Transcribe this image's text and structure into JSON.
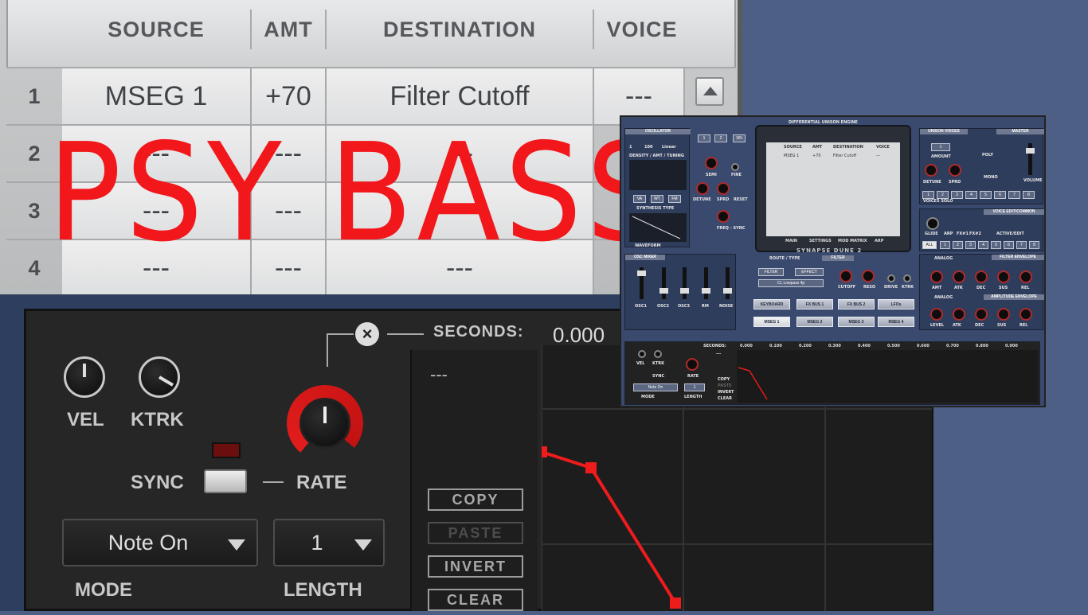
{
  "overlay_title": "PSY BASS",
  "matrix": {
    "headers": [
      "SOURCE",
      "AMT",
      "DESTINATION",
      "VOICE"
    ],
    "rows": [
      {
        "num": "1",
        "source": "MSEG 1",
        "amt": "+70",
        "destination": "Filter Cutoff",
        "voice": "---"
      },
      {
        "num": "2",
        "source": "---",
        "amt": "---",
        "destination": "---",
        "voice": ""
      },
      {
        "num": "3",
        "source": "---",
        "amt": "---",
        "destination": "---",
        "voice": ""
      },
      {
        "num": "4",
        "source": "---",
        "amt": "---",
        "destination": "---",
        "voice": ""
      }
    ]
  },
  "mseg": {
    "vel_label": "VEL",
    "ktrk_label": "KTRK",
    "sync_label": "SYNC",
    "rate_label": "RATE",
    "seconds_label": "SECONDS:",
    "seconds_value": "0.000",
    "placeholder": "---",
    "mode_value": "Note On",
    "mode_label": "MODE",
    "length_value": "1",
    "length_label": "LENGTH",
    "copy": "COPY",
    "paste": "PASTE",
    "invert": "INVERT",
    "clear": "CLEAR",
    "accent": "#ee1c1c"
  },
  "synth": {
    "osc_header": "OSCILLATOR",
    "osc_vals": [
      "1",
      "100",
      "Linear"
    ],
    "density_label": "DENSITY / AMT / TUNING",
    "synthesis_btns": [
      "VA",
      "WT",
      "FM"
    ],
    "synthesis_label": "SYNTHESIS TYPE",
    "waveform_label": "WAVEFORM",
    "osc_tabs": [
      "1",
      "2",
      "3/N"
    ],
    "semi": "SEMI",
    "fine": "FINE",
    "detune": "DETUNE",
    "sprd": "SPRD",
    "reset": "RESET",
    "freq_sync": "FREQ - SYNC",
    "engine_title": "DIFFERENTIAL UNISON ENGINE",
    "screen_headers": [
      "SOURCE",
      "AMT",
      "DESTINATION",
      "VOICE"
    ],
    "screen_row1": [
      "MSEG 1",
      "+70",
      "Filter Cutoff",
      "---"
    ],
    "screen_tabs": [
      "MAIN",
      "SETTINGS",
      "MOD MATRIX",
      "ARP"
    ],
    "brand": "SYNAPSE DUNE 2",
    "unison_header": "UNISON VOICES",
    "unison_val": "1",
    "amount": "AMOUNT",
    "u_detune": "DETUNE",
    "u_sprd": "SPRD",
    "voices_solo": "VOICES SOLO",
    "master_header": "MASTER",
    "poly": "POLY",
    "mono": "MONO",
    "volume": "VOLUME",
    "voice_edit_header": "VOICE EDIT/COMMON",
    "glide": "GLIDE",
    "arp": "ARP",
    "fx1": "FX#1",
    "fx2": "FX#2",
    "active_edit": "ACTIVE/EDIT",
    "all": "ALL",
    "voice_nums": [
      "1",
      "2",
      "3",
      "4",
      "5",
      "6",
      "7",
      "8"
    ],
    "mixer_header": "OSC MIXER",
    "mixer_ch": [
      "OSC1",
      "OSC2",
      "OSC3",
      "RM",
      "NOISE"
    ],
    "route_type": "ROUTE / TYPE",
    "filter_header": "FILTER",
    "filter_dd": "FILTER",
    "effect_dd": "EFFECT",
    "filter_type": "CL Lowpass 4p",
    "cutoff": "CUTOFF",
    "reso": "RESO",
    "drive": "DRIVE",
    "ktrk": "KTRK",
    "mod_btns_row1": [
      "KEYBOARD",
      "FX BUS 1",
      "FX BUS 2",
      "LFOs"
    ],
    "mod_btns_row2": [
      "MSEG 1",
      "MSEG 2",
      "MSEG 3",
      "MSEG 4"
    ],
    "filter_env_header": "FILTER ENVELOPE",
    "analog": "ANALOG",
    "fenv": [
      "AMT",
      "ATK",
      "DEC",
      "SUS",
      "REL"
    ],
    "amp_env_header": "AMPLITUDE ENVELOPE",
    "aenv": [
      "LEVEL",
      "ATK",
      "DEC",
      "SUS",
      "REL"
    ],
    "mini_seconds": "SECONDS:",
    "ruler": [
      "0.000",
      "0.100",
      "0.200",
      "0.300",
      "0.400",
      "0.500",
      "0.600",
      "0.700",
      "0.800",
      "0.900"
    ],
    "mini_btns": [
      "COPY",
      "PASTE",
      "INVERT",
      "CLEAR"
    ],
    "mini_vel": "VEL",
    "mini_ktrk": "KTRK",
    "mini_sync": "SYNC",
    "mini_rate": "RATE",
    "mini_mode": "Note On",
    "mini_len": "1",
    "mini_mode_lbl": "MODE",
    "mini_len_lbl": "LENGTH",
    "mini_placeholder": "---"
  }
}
